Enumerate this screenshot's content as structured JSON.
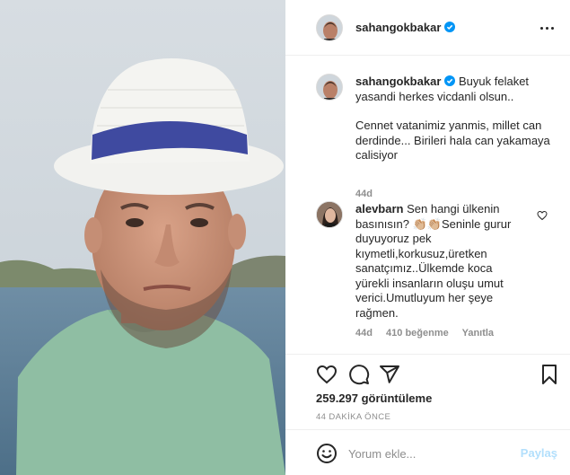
{
  "colors": {
    "accent": "#0095f6",
    "accent_disabled": "#b2dffc",
    "secondary_text": "#8e8e8e",
    "border": "#efefef"
  },
  "post": {
    "username": "sahangokbakar",
    "verified": true
  },
  "caption": {
    "username": "sahangokbakar",
    "text_1": "Buyuk felaket yasandi herkes vicdanli olsun..",
    "text_2": "Cennet vatanimiz yanmis, millet can derdinde... Birileri hala can yakamaya calisiyor",
    "time": "44d"
  },
  "comment": {
    "username": "alevbarn",
    "text": "Sen hangi ülkenin basınısın? 👏🏼👏🏼Seninle gurur duyuyoruz pek kıymetli,korkusuz,üretken sanatçımız..Ülkemde koca yürekli insanların oluşu umut verici.Umutluyum her şeye rağmen.",
    "time": "44d",
    "likes": "410 beğenme",
    "reply": "Yanıtla"
  },
  "actions": {
    "icons": [
      "heart-icon",
      "comment-icon",
      "share-icon",
      "bookmark-icon"
    ]
  },
  "stats": {
    "views": "259.297 görüntüleme",
    "ago": "44 DAKİKA ÖNCE"
  },
  "add_comment": {
    "placeholder": "Yorum ekle...",
    "post_label": "Paylaş"
  }
}
